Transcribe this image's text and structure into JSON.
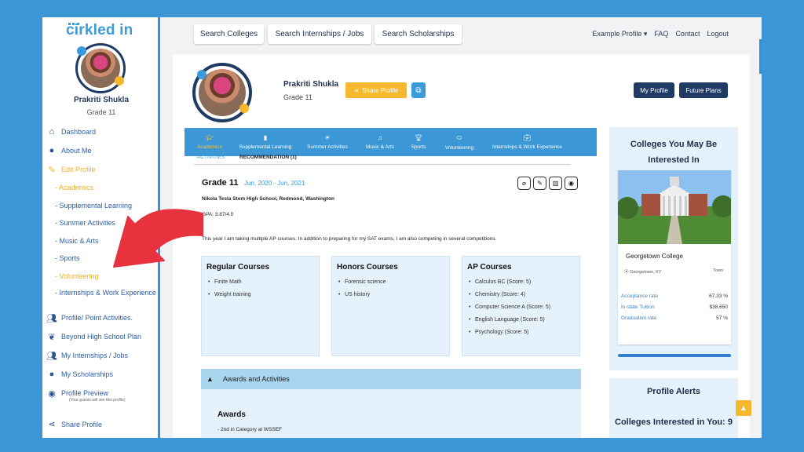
{
  "brand": {
    "logo_text": "cirkled in"
  },
  "sidebar": {
    "name": "Prakriti Shukla",
    "grade": "Grade 11",
    "items": [
      {
        "label": "Dashboard",
        "icon": "home-icon"
      },
      {
        "label": "About Me",
        "icon": "user-icon"
      },
      {
        "label": "Edit Profile",
        "icon": "edit-icon"
      }
    ],
    "subitems": [
      "- Academics",
      "- Supplemental Learning",
      "- Summer Activities",
      "- Music & Arts",
      "- Sports",
      "- Volunteering",
      "- Internships & Work Experience"
    ],
    "items2": [
      {
        "label": "Profile/ Point Activities.",
        "icon": "users-icon"
      },
      {
        "label": "Beyond High School Plan",
        "icon": "leaf-icon"
      },
      {
        "label": "My Internships / Jobs",
        "icon": "users-icon"
      },
      {
        "label": "My Scholarships",
        "icon": "user-icon"
      },
      {
        "label": "Profile Preview",
        "icon": "eye-icon"
      }
    ],
    "preview_note": "(Your guests will see this profile)",
    "share_label": "Share Profile"
  },
  "topbar": {
    "search_colleges": "Search Colleges",
    "search_internships": "Search Internships / Jobs",
    "search_scholarships": "Search Scholarships",
    "example_profile": "Example Profile",
    "faq": "FAQ",
    "contact": "Contact",
    "logout": "Logout"
  },
  "profile": {
    "name": "Prakriti Shukla",
    "grade": "Grade 11",
    "share_button": "Share Profile",
    "my_profile": "My Profile",
    "future_plans": "Future Plans"
  },
  "tabs": [
    {
      "label": "Academics",
      "icon": "graduation-cap-icon"
    },
    {
      "label": "Supplemental Learning",
      "icon": "book-icon"
    },
    {
      "label": "Summer Activities",
      "icon": "sun-icon"
    },
    {
      "label": "Music & Arts",
      "icon": "music-icon"
    },
    {
      "label": "Sports",
      "icon": "trophy-icon"
    },
    {
      "label": "Volunteering",
      "icon": "handshake-icon"
    },
    {
      "label": "Internships & Work Experience",
      "icon": "briefcase-icon"
    }
  ],
  "subtabs": {
    "activities": "ACTIVITIES",
    "recommendation": "RECOMMENDATION (1)"
  },
  "academics": {
    "grade_heading": "Grade 11",
    "date_range": "Jun, 2020 - Jun, 2021",
    "school": "Nikola Tesla Stem High School, Redmond, Washington",
    "gpa": "GPA: 3.87/4.0",
    "description": "This year I am taking multiple AP courses. In addition to preparing for my SAT exams, I am also competing in several competitions.",
    "regular": {
      "title": "Regular Courses",
      "items": [
        "Finite Math",
        "Weight training"
      ]
    },
    "honors": {
      "title": "Honors Courses",
      "items": [
        "Forensic science",
        "US history"
      ]
    },
    "ap": {
      "title": "AP Courses",
      "items": [
        "Calculus BC (Score: 5)",
        "Chemistry (Score: 4)",
        "Computer Science A (Score: 5)",
        "English Language (Score: 5)",
        "Psychology (Score: 5)"
      ]
    }
  },
  "awards": {
    "bar_label": "Awards and Activities",
    "title": "Awards",
    "item": "- 2nd in Category at WSSEF"
  },
  "colleges_panel": {
    "title": "Colleges You May Be Interested In",
    "college_name": "Georgetown College",
    "location": "Georgetown, KY",
    "setting": "Town",
    "stats": [
      {
        "label": "Acceptance rate",
        "value": "67.33 %"
      },
      {
        "label": "In-state Tuition",
        "value": "$38,650"
      },
      {
        "label": "Graduation rate",
        "value": "57 %"
      }
    ]
  },
  "alerts_panel": {
    "title": "Profile Alerts",
    "interested": "Colleges Interested in You: 9"
  },
  "colors": {
    "accent_blue": "#3b97d6",
    "navy": "#1f3b63",
    "yellow": "#f5b82e",
    "arrow_red": "#e8323d"
  }
}
